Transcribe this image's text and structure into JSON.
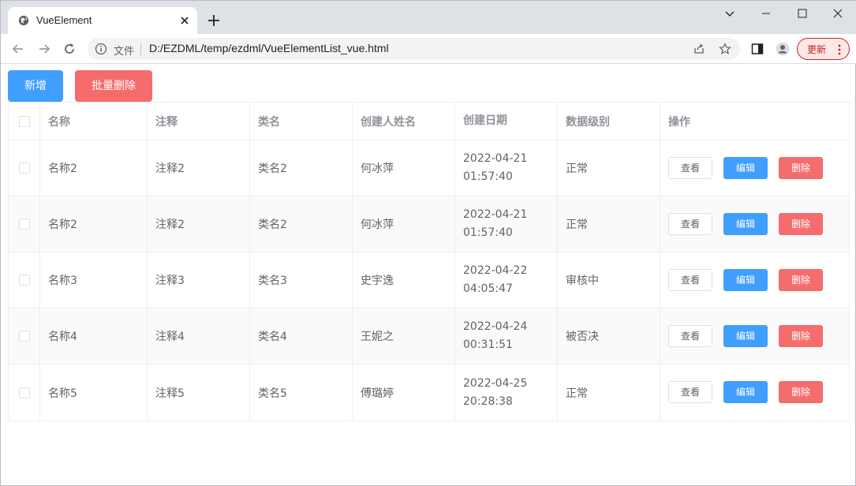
{
  "browser": {
    "tab_title": "VueElement",
    "address_label": "文件",
    "url": "D:/EZDML/temp/ezdml/VueElementList_vue.html",
    "update_label": "更新",
    "accent_update": "#c5221f"
  },
  "page": {
    "add_label": "新增",
    "batch_delete_label": "批量删除",
    "colors": {
      "primary": "#409eff",
      "danger": "#f56c6c",
      "border": "#ebeef5",
      "header_text": "#909399"
    },
    "table": {
      "headers": [
        "名称",
        "注释",
        "类名",
        "创建人姓名",
        "创建日期",
        "数据级别",
        "操作"
      ],
      "rows": [
        {
          "name": "名称2",
          "comment": "注释2",
          "classname": "类名2",
          "creator": "何冰萍",
          "date": "2022-04-21 01:57:40",
          "level": "正常",
          "view": "查看",
          "edit": "编辑",
          "delete": "删除"
        },
        {
          "name": "名称2",
          "comment": "注释2",
          "classname": "类名2",
          "creator": "何冰萍",
          "date": "2022-04-21 01:57:40",
          "level": "正常",
          "view": "查看",
          "edit": "编辑",
          "delete": "删除"
        },
        {
          "name": "名称3",
          "comment": "注释3",
          "classname": "类名3",
          "creator": "史宇逸",
          "date": "2022-04-22 04:05:47",
          "level": "审核中",
          "view": "查看",
          "edit": "编辑",
          "delete": "删除"
        },
        {
          "name": "名称4",
          "comment": "注释4",
          "classname": "类名4",
          "creator": "王妮之",
          "date": "2022-04-24 00:31:51",
          "level": "被否决",
          "view": "查看",
          "edit": "编辑",
          "delete": "删除"
        },
        {
          "name": "名称5",
          "comment": "注释5",
          "classname": "类名5",
          "creator": "傅璐婷",
          "date": "2022-04-25 20:28:38",
          "level": "正常",
          "view": "查看",
          "edit": "编辑",
          "delete": "删除"
        }
      ]
    }
  }
}
